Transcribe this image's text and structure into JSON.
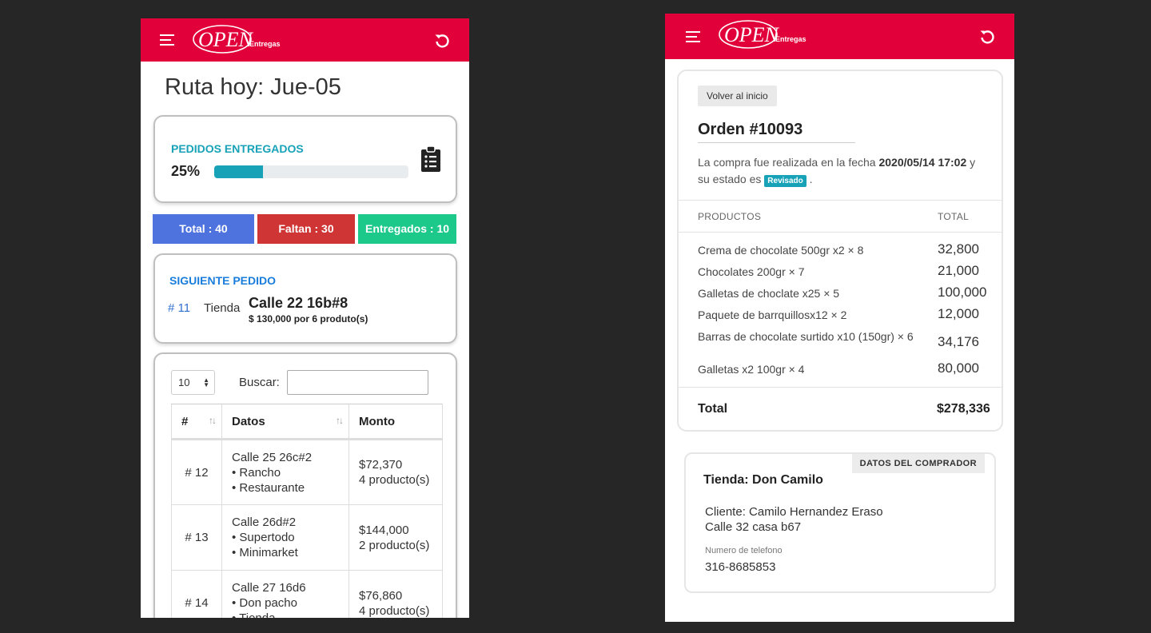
{
  "brand": {
    "logo_text": "OPEN",
    "logo_sub": "Entregas",
    "primary_color": "#e2003a"
  },
  "left": {
    "title": "Ruta hoy: Jue-05",
    "progress": {
      "title": "PEDIDOS ENTREGADOS",
      "percent_label": "25%",
      "percent": 25,
      "color": "#17a2b8"
    },
    "stats": {
      "total": "Total : 40",
      "faltan": "Faltan : 30",
      "entregados": "Entregados : 10"
    },
    "next_order": {
      "title": "SIGUIENTE PEDIDO",
      "number": "# 11",
      "type": "Tienda",
      "address": "Calle 22 16b#8",
      "amount": "$ 130,000 por 6 produto(s)"
    },
    "table": {
      "page_length": "10",
      "search_label": "Buscar:",
      "search_value": "",
      "columns": [
        "#",
        "Datos",
        "Monto"
      ],
      "rows": [
        {
          "num": "# 12",
          "address": "Calle 25 26c#2",
          "line2": "• Rancho",
          "line3": "• Restaurante",
          "amount": "$72,370",
          "count": "4 producto(s)"
        },
        {
          "num": "# 13",
          "address": "Calle 26d#2",
          "line2": "• Supertodo",
          "line3": "• Minimarket",
          "amount": "$144,000",
          "count": "2 producto(s)"
        },
        {
          "num": "# 14",
          "address": "Calle 27 16d6",
          "line2": "• Don pacho",
          "line3": "• Tienda",
          "amount": "$76,860",
          "count": "4 producto(s)"
        }
      ]
    }
  },
  "right": {
    "back_label": "Volver al inicio",
    "order_title": "Orden #10093",
    "desc_prefix": "La compra fue realizada en la fecha ",
    "date": "2020/05/14 17:02",
    "desc_mid": " y su estado es ",
    "status": "Revisado",
    "desc_suffix": " .",
    "col_products": "PRODUCTOS",
    "col_total": "TOTAL",
    "products": [
      {
        "name": "Crema de chocolate 500gr x2 × 8",
        "total": "32,800"
      },
      {
        "name": "Chocolates 200gr × 7",
        "total": "21,000"
      },
      {
        "name": "Galletas de choclate x25 × 5",
        "total": "100,000"
      },
      {
        "name": "Paquete de barrquillosx12 × 2",
        "total": "12,000"
      },
      {
        "name": "Barras de chocolate surtido x10 (150gr) × 6",
        "total": "34,176"
      },
      {
        "name": "Galletas x2 100gr × 4",
        "total": "80,000"
      }
    ],
    "total_label": "Total",
    "total_value": "$278,336",
    "buyer": {
      "tag": "DATOS DEL COMPRADOR",
      "store": "Tienda: Don Camilo",
      "client": "Cliente: Camilo Hernandez Eraso",
      "address": "Calle 32 casa b67",
      "phone_label": "Numero de telefono",
      "phone": "316-8685853"
    }
  }
}
